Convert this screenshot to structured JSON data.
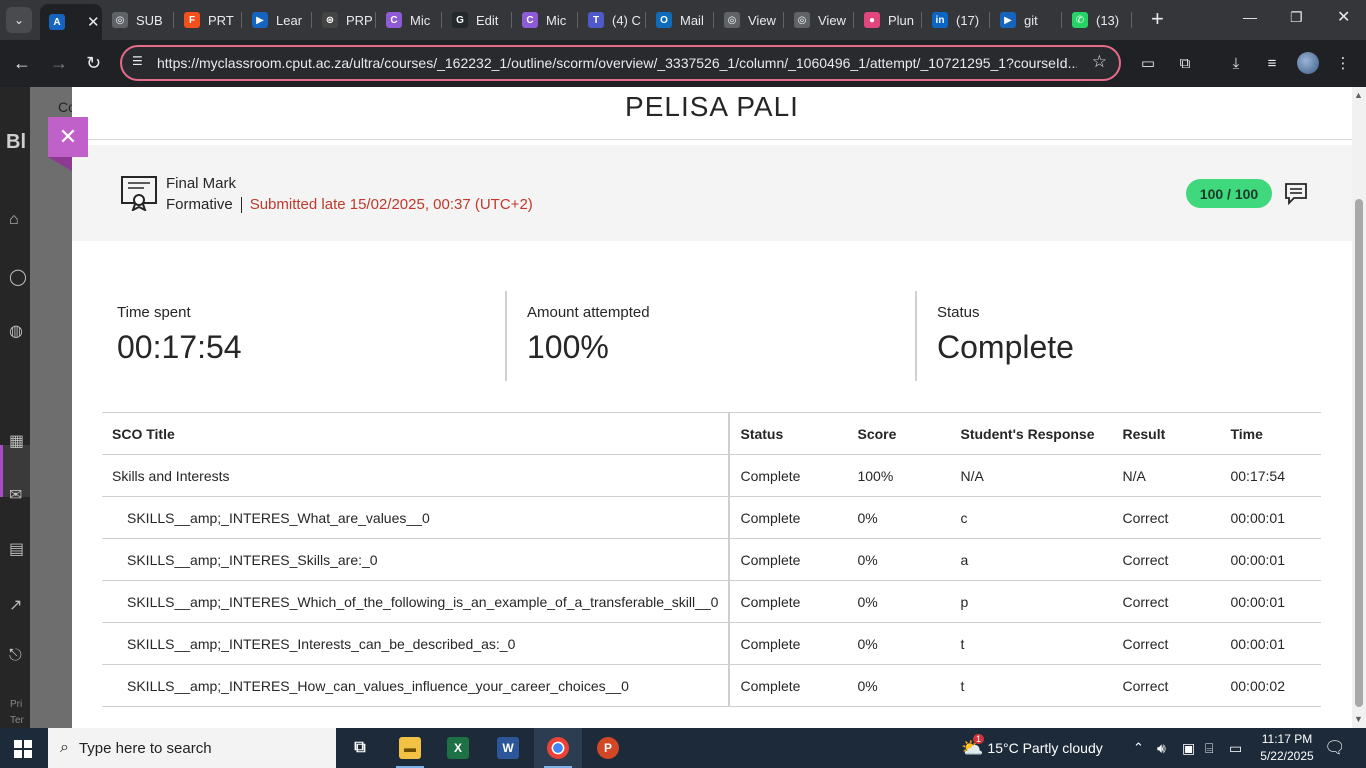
{
  "browser": {
    "tabs": [
      {
        "label": "",
        "favicon_color": "#1565c0",
        "favicon_text": "A",
        "active": true
      },
      {
        "label": "SUB",
        "favicon_color": "#5f6368",
        "favicon_text": "◎"
      },
      {
        "label": "PRT",
        "favicon_color": "#f24e1e",
        "favicon_text": "F"
      },
      {
        "label": "Lear",
        "favicon_color": "#1565c0",
        "favicon_text": "▶"
      },
      {
        "label": "PRP",
        "favicon_color": "#444444",
        "favicon_text": "⊛"
      },
      {
        "label": "Mic",
        "favicon_color": "#8e5bd6",
        "favicon_text": "C"
      },
      {
        "label": "Edit",
        "favicon_color": "#24292e",
        "favicon_text": "G"
      },
      {
        "label": "Mic",
        "favicon_color": "#8e5bd6",
        "favicon_text": "C"
      },
      {
        "label": "(4) C",
        "favicon_color": "#5059c9",
        "favicon_text": "T"
      },
      {
        "label": "Mail",
        "favicon_color": "#0f6cbd",
        "favicon_text": "O"
      },
      {
        "label": "View",
        "favicon_color": "#5f6368",
        "favicon_text": "◎"
      },
      {
        "label": "View",
        "favicon_color": "#5f6368",
        "favicon_text": "◎"
      },
      {
        "label": "Plun",
        "favicon_color": "#e0457b",
        "favicon_text": "●"
      },
      {
        "label": "(17)",
        "favicon_color": "#0a66c2",
        "favicon_text": "in"
      },
      {
        "label": "git",
        "favicon_color": "#1565c0",
        "favicon_text": "▶"
      },
      {
        "label": "(13)",
        "favicon_color": "#25d366",
        "favicon_text": "✆"
      }
    ],
    "url": "https://myclassroom.cput.ac.za/ultra/courses/_162232_1/outline/scorm/overview/_3337526_1/column/_1060496_1/attempt/_10721295_1?courseId..."
  },
  "sidebar": {
    "logo": "Bl",
    "course_prefix": "Co",
    "footer_1": "Pri",
    "footer_2": "Ter"
  },
  "panel": {
    "student_name": "PELISA PALI",
    "grade": {
      "title": "Final Mark",
      "category": "Formative",
      "submission": "Submitted late 15/02/2025, 00:37 (UTC+2)",
      "score": "100 / 100"
    },
    "stats": [
      {
        "label": "Time spent",
        "value": "00:17:54"
      },
      {
        "label": "Amount attempted",
        "value": "100%"
      },
      {
        "label": "Status",
        "value": "Complete"
      }
    ],
    "table": {
      "headers": [
        "SCO Title",
        "Status",
        "Score",
        "Student's Response",
        "Result",
        "Time"
      ],
      "rows": [
        [
          "Skills and Interests",
          "Complete",
          "100%",
          "N/A",
          "N/A",
          "00:17:54"
        ],
        [
          "SKILLS__amp;_INTERES_What_are_values__0",
          "Complete",
          "0%",
          "c",
          "Correct",
          "00:00:01"
        ],
        [
          "SKILLS__amp;_INTERES_Skills_are:_0",
          "Complete",
          "0%",
          "a",
          "Correct",
          "00:00:01"
        ],
        [
          "SKILLS__amp;_INTERES_Which_of_the_following_is_an_example_of_a_transferable_skill__0",
          "Complete",
          "0%",
          "p",
          "Correct",
          "00:00:01"
        ],
        [
          "SKILLS__amp;_INTERES_Interests_can_be_described_as:_0",
          "Complete",
          "0%",
          "t",
          "Correct",
          "00:00:01"
        ],
        [
          "SKILLS__amp;_INTERES_How_can_values_influence_your_career_choices__0",
          "Complete",
          "0%",
          "t",
          "Correct",
          "00:00:02"
        ]
      ]
    }
  },
  "taskbar": {
    "search_placeholder": "Type here to search",
    "weather_badge": "1",
    "weather": "15°C  Partly cloudy",
    "time": "11:17 PM",
    "date": "5/22/2025"
  },
  "colors": {
    "accent": "#c060c9",
    "score_pill": "#3fd87d",
    "late": "#c0392b"
  }
}
